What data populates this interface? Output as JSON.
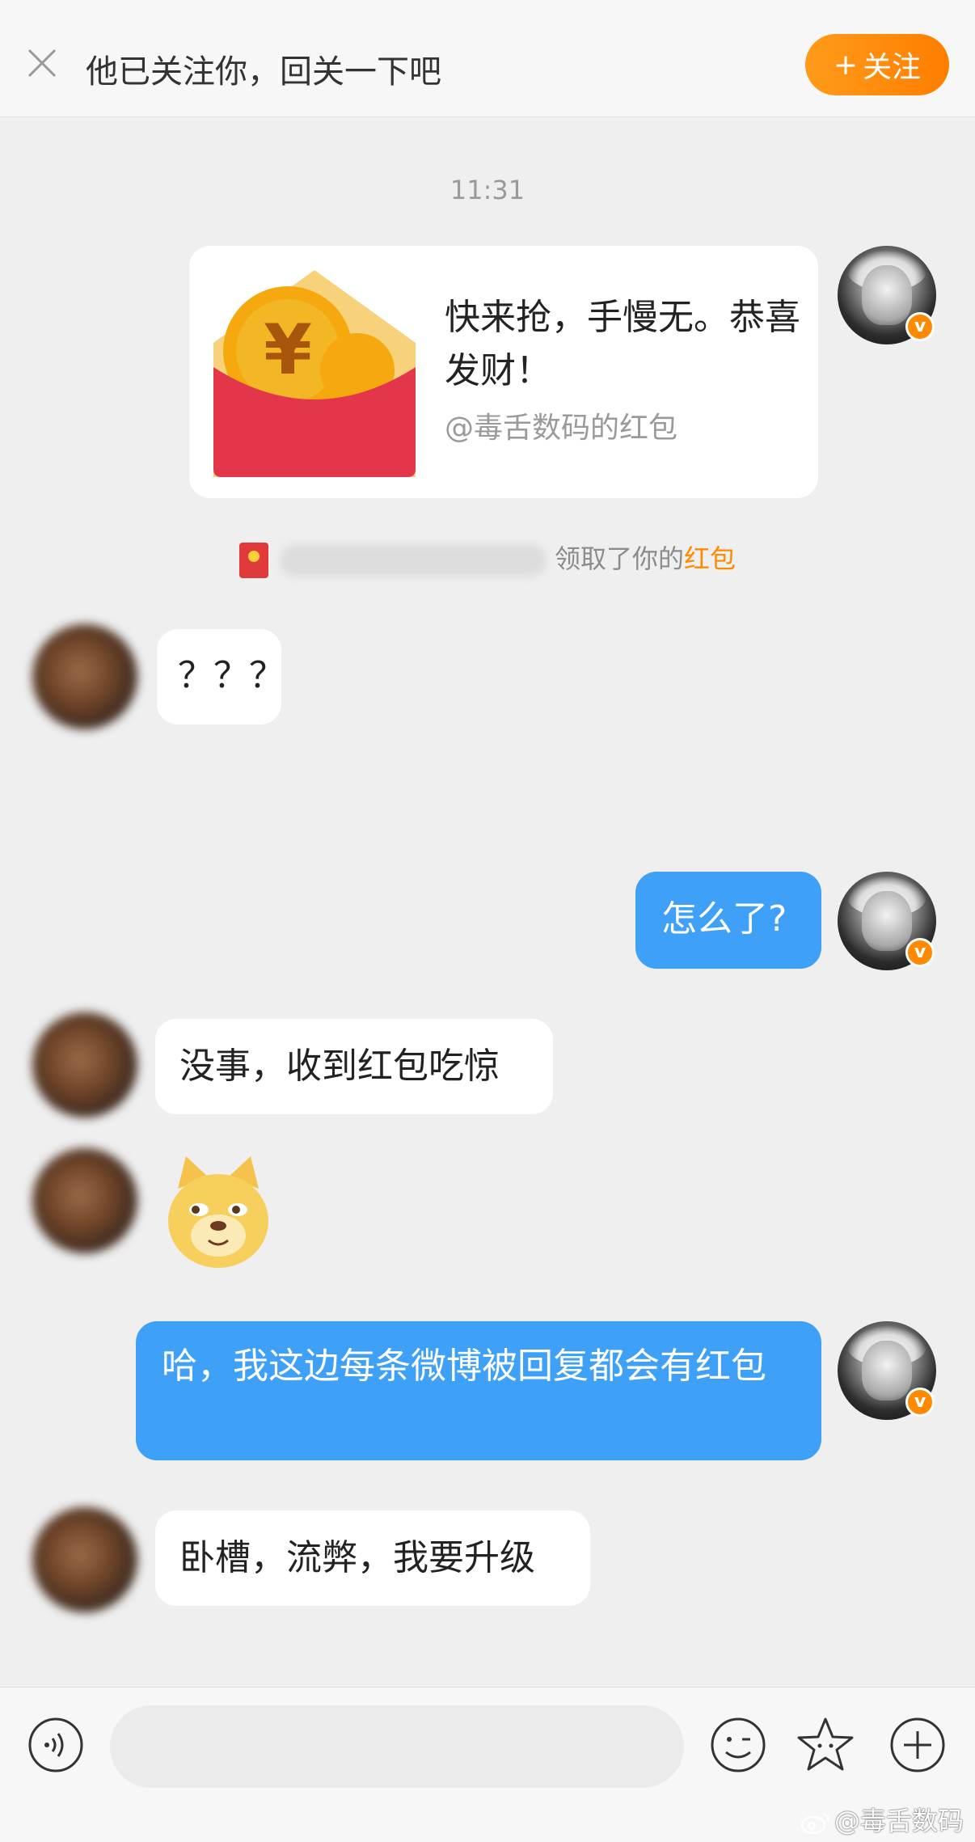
{
  "header": {
    "title": "他已关注你，回关一下吧",
    "follow_label": "关注",
    "close_icon": "close-icon"
  },
  "timestamp": "11:31",
  "red_packet": {
    "message": "快来抢，手慢无。恭喜发财！",
    "sender_line": "@毒舌数码的红包"
  },
  "notice": {
    "text": "领取了你的",
    "highlight": "红包"
  },
  "messages": [
    {
      "side": "left",
      "text": "？？？"
    },
    {
      "side": "right",
      "text": "怎么了?"
    },
    {
      "side": "left",
      "text": "没事，收到红包吃惊"
    },
    {
      "side": "left",
      "type": "sticker",
      "sticker": "doge-emoji"
    },
    {
      "side": "right",
      "text": "哈，我这边每条微博被回复都会有红包"
    },
    {
      "side": "left",
      "text": "卧槽，流弊，我要升级"
    }
  ],
  "input": {
    "placeholder": ""
  },
  "watermark": "@毒舌数码",
  "colors": {
    "accent": "#ff8a00",
    "bubble_blue": "#3fa0f7",
    "red_packet": "#e03a3a"
  }
}
